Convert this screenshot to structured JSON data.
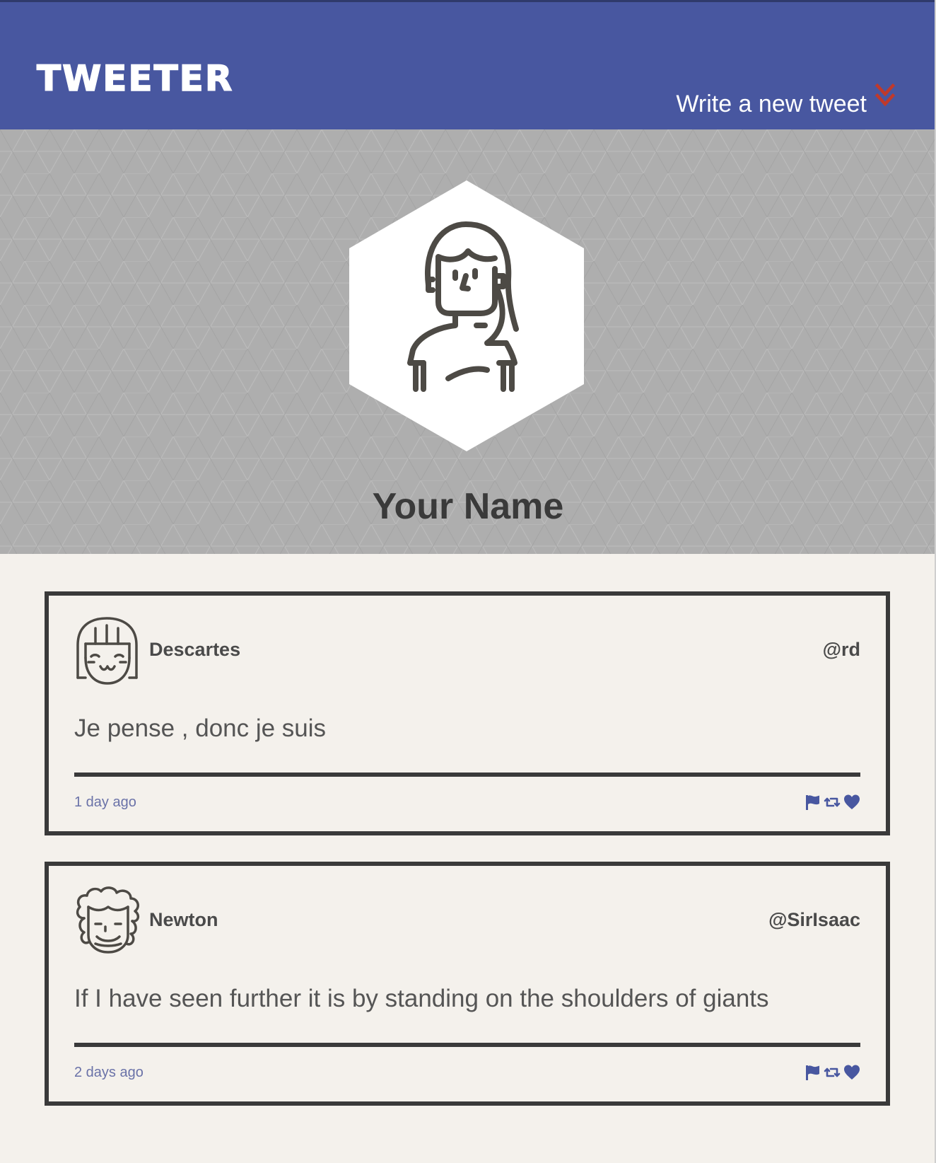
{
  "nav": {
    "brand": "TWEETER",
    "compose_label": "Write a new tweet",
    "compose_icon": "double-chevron-down-icon",
    "accent_color": "#c0392b",
    "background_color": "#4857a0"
  },
  "profile": {
    "name": "Your Name",
    "avatar_icon": "user-avatar-icon"
  },
  "tweets": [
    {
      "author": "Descartes",
      "handle": "@rd",
      "text": "Je pense , donc je suis",
      "time": "1 day ago",
      "avatar_icon": "descartes-avatar-icon",
      "actions": [
        "flag-icon",
        "retweet-icon",
        "heart-icon"
      ]
    },
    {
      "author": "Newton",
      "handle": "@SirIsaac",
      "text": "If I have seen further it is by standing on the shoulders of giants",
      "time": "2 days ago",
      "avatar_icon": "newton-avatar-icon",
      "actions": [
        "flag-icon",
        "retweet-icon",
        "heart-icon"
      ]
    }
  ],
  "colors": {
    "action_icons": "#4857a0",
    "border": "#3a3a3a",
    "page_background": "#f4f1ec"
  }
}
